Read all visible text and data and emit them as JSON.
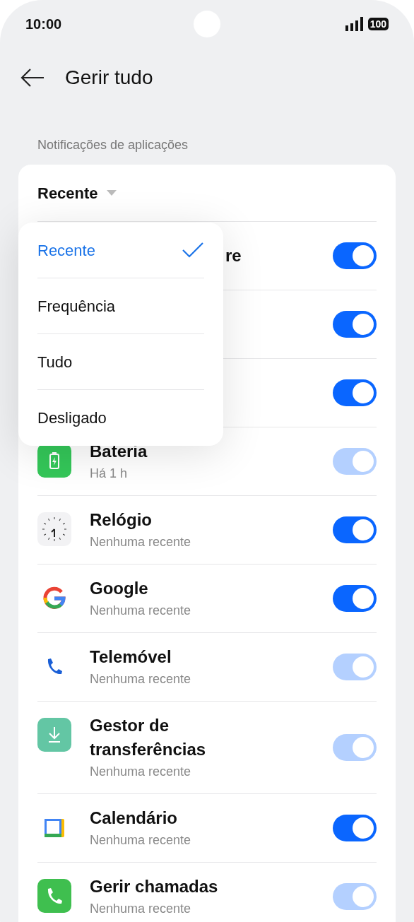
{
  "status_bar": {
    "time": "10:00",
    "battery": "100"
  },
  "header": {
    "title": "Gerir tudo"
  },
  "section_label": "Notificações de aplicações",
  "sort": {
    "label": "Recente",
    "expanded": true
  },
  "sort_menu": [
    {
      "label": "Recente",
      "selected": true
    },
    {
      "label": "Frequência",
      "selected": false
    },
    {
      "label": "Tudo",
      "selected": false
    },
    {
      "label": "Desligado",
      "selected": false
    }
  ],
  "apps": [
    {
      "kind": "covered",
      "title": "re",
      "on": true,
      "disabled": false
    },
    {
      "kind": "covered",
      "on": true,
      "disabled": false
    },
    {
      "kind": "covered",
      "on": true,
      "disabled": false
    },
    {
      "kind": "battery",
      "title": "Bateria",
      "subtitle": "Há 1 h",
      "on": true,
      "disabled": true
    },
    {
      "kind": "clock",
      "title": "Relógio",
      "subtitle": "Nenhuma recente",
      "on": true,
      "disabled": false
    },
    {
      "kind": "google",
      "title": "Google",
      "subtitle": "Nenhuma recente",
      "on": true,
      "disabled": false
    },
    {
      "kind": "phone",
      "title": "Telemóvel",
      "subtitle": "Nenhuma recente",
      "on": true,
      "disabled": true
    },
    {
      "kind": "download",
      "title": "Gestor de transferências",
      "subtitle": "Nenhuma recente",
      "on": true,
      "disabled": true
    },
    {
      "kind": "calendar",
      "title": "Calendário",
      "subtitle": "Nenhuma recente",
      "on": true,
      "disabled": false
    },
    {
      "kind": "call",
      "title": "Gerir chamadas",
      "subtitle": "Nenhuma recente",
      "on": true,
      "disabled": true
    }
  ]
}
